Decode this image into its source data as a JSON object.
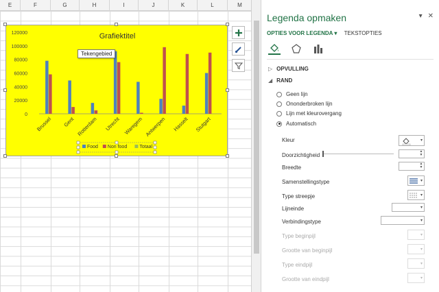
{
  "columns": [
    "E",
    "F",
    "G",
    "H",
    "I",
    "J",
    "K",
    "L",
    "M"
  ],
  "chart": {
    "title": "Grafiektitel",
    "tooltip": "Tekengebied",
    "background": "#ffff00"
  },
  "chart_data": {
    "type": "bar",
    "title": "Grafiektitel",
    "categories": [
      "Brussel",
      "Gent",
      "Rotterdam",
      "Utrecht",
      "Waregem",
      "Antwerpen",
      "Hasselt",
      "Stutgart"
    ],
    "series": [
      {
        "name": "Food",
        "color": "#4f81bd",
        "values": [
          78000,
          49000,
          16000,
          92000,
          47000,
          22000,
          12000,
          60000
        ]
      },
      {
        "name": "Non food",
        "color": "#c0504d",
        "values": [
          58000,
          10000,
          5000,
          76000,
          1500,
          98000,
          88000,
          90000
        ]
      },
      {
        "name": "Totaal",
        "color": "#9bbb59",
        "values": [
          0,
          0,
          0,
          0,
          0,
          0,
          0,
          0
        ]
      }
    ],
    "yticks": [
      "0",
      "20000",
      "40000",
      "60000",
      "80000",
      "100000",
      "120000"
    ],
    "ylim": [
      0,
      120000
    ],
    "legend": "bottom"
  },
  "panel": {
    "title": "Legenda opmaken",
    "tab_legend": "OPTIES VOOR LEGENDA",
    "tab_text": "TEKSTOPTIES",
    "section_fill": "OPVULLING",
    "section_border": "RAND",
    "radios": [
      "Geen lijn",
      "Ononderbroken lijn",
      "Lijn met kleurovergang",
      "Automatisch"
    ],
    "props": {
      "kleur": "Kleur",
      "doorzichtigheid": "Doorzichtigheid",
      "breedte": "Breedte",
      "samenstellingstype": "Samenstellingstype",
      "type_streepje": "Type streepje",
      "lijneinde": "Lijneinde",
      "verbindingstype": "Verbindingstype",
      "type_beginpijl": "Type beginpijl",
      "grootte_beginpijl": "Grootte van beginpijl",
      "type_eindpijl": "Type eindpijl",
      "grootte_eindpijl": "Grootte van eindpijl"
    }
  }
}
